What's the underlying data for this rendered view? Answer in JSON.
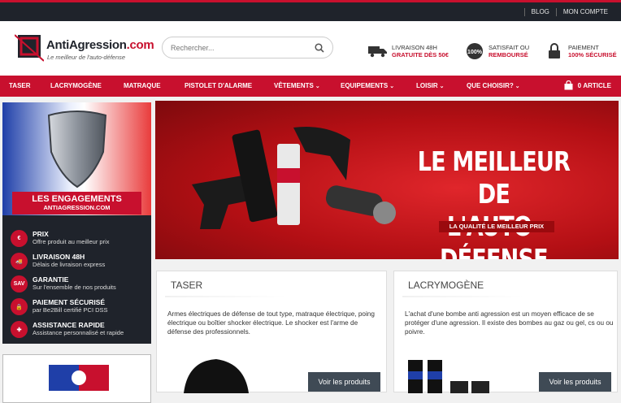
{
  "topbar": {
    "links": [
      "BLOG",
      "MON COMPTE"
    ]
  },
  "header": {
    "logo_name": "AntiAgression",
    "logo_suffix": ".com",
    "logo_tagline": "Le meilleur de l'auto-défense",
    "search_placeholder": "Rechercher...",
    "benefits": [
      {
        "icon": "truck-icon",
        "line1": "LIVRAISON 48H",
        "line2": "GRATUITE DÈS 50€"
      },
      {
        "icon": "badge-100-icon",
        "line1": "SATISFAIT OU",
        "line2": "REMBOURSÉ"
      },
      {
        "icon": "lock-icon",
        "line1": "PAIEMENT",
        "line2": "100% SÉCURISÉ"
      }
    ]
  },
  "nav": {
    "items": [
      {
        "label": "TASER",
        "dropdown": false
      },
      {
        "label": "LACRYMOGÈNE",
        "dropdown": false
      },
      {
        "label": "MATRAQUE",
        "dropdown": false
      },
      {
        "label": "PISTOLET D'ALARME",
        "dropdown": false
      },
      {
        "label": "VÊTEMENTS",
        "dropdown": true
      },
      {
        "label": "EQUIPEMENTS",
        "dropdown": true
      },
      {
        "label": "LOISIR",
        "dropdown": true
      },
      {
        "label": "QUE CHOISIR?",
        "dropdown": true
      }
    ],
    "cart_count": "0",
    "cart_label": "ARTICLE",
    "caret": "⌄"
  },
  "sidebar": {
    "banner_title": "LES ENGAGEMENTS",
    "banner_subtitle": "ANTIAGRESSION.COM",
    "engagements": [
      {
        "icon_text": "€",
        "title": "PRIX",
        "desc": "Offre produit au meilleur prix"
      },
      {
        "icon_text": "🚚",
        "title": "LIVRAISON 48H",
        "desc": "Délais de livraison express"
      },
      {
        "icon_text": "SAV",
        "title": "GARANTIE",
        "desc": "Sur l'ensemble de nos produits"
      },
      {
        "icon_text": "🔒",
        "title": "PAIEMENT SÉCURISÉ",
        "desc": "par Be2Bill certifié PCI DSS"
      },
      {
        "icon_text": "✚",
        "title": "ASSISTANCE RAPIDE",
        "desc": "Assistance personnalisé et rapide"
      }
    ]
  },
  "hero": {
    "title_line1": "LE MEILLEUR DE",
    "title_line2": "L'AUTO-DÉFENSE",
    "tagline": "LA QUALITÉ LE MEILLEUR PRIX"
  },
  "categories": [
    {
      "title": "TASER",
      "desc": "Armes électriques de défense de tout type, matraque électrique, poing électrique ou boîtier shocker électrique. Le shocker est l'arme de défense des professionnels.",
      "button": "Voir les produits"
    },
    {
      "title": "LACRYMOGÈNE",
      "desc": "L'achat d'une bombe anti agression est un moyen efficace de se protéger d'une agression. Il existe des bombes au gaz ou gel, cs ou ou poivre.",
      "button": "Voir les produits"
    }
  ],
  "colors": {
    "brand_red": "#c8102e",
    "dark": "#1f232b",
    "button": "#3f4a55"
  }
}
